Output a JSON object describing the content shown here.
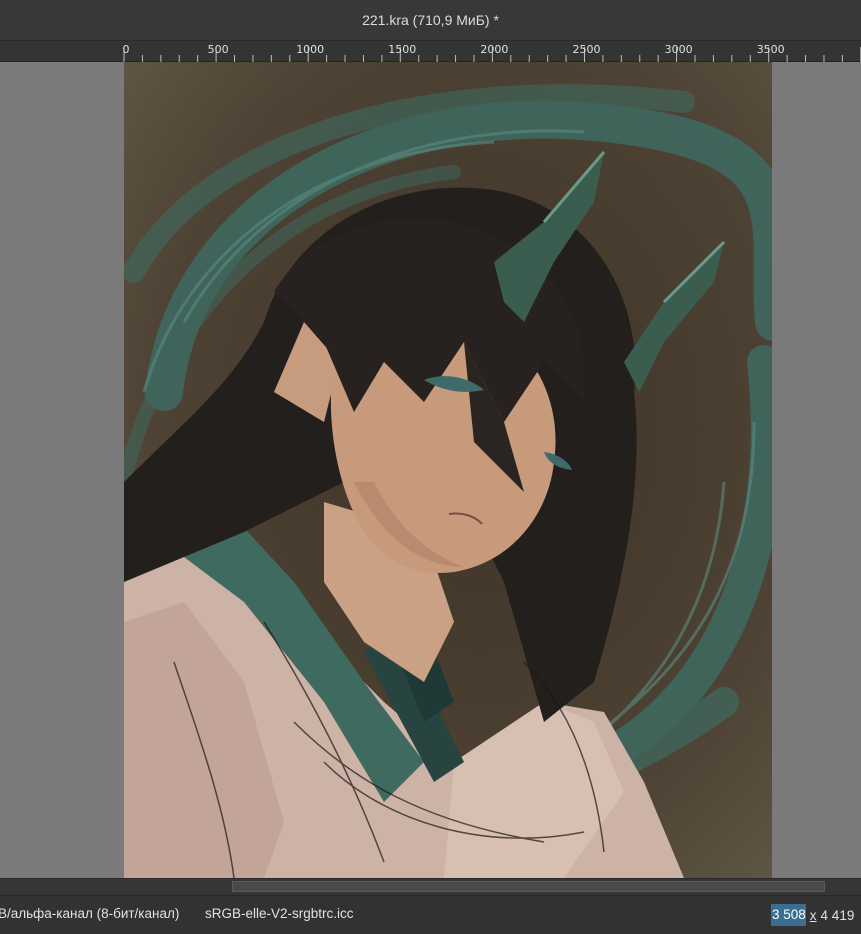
{
  "window": {
    "title": "221.kra (710,9 МиБ) *"
  },
  "ruler": {
    "labels": [
      "0",
      "500",
      "1000",
      "1500",
      "2000",
      "2500",
      "3000",
      "3500"
    ]
  },
  "canvas": {
    "artwork": "digital painting: dark-haired figure with green dragon horns and pointed ear, teal brush swirls on brown background"
  },
  "statusbar": {
    "color_space": "В/альфа-канал (8-бит/канал)",
    "profile": "sRGB-elle-V2-srgbtrc.icc",
    "width": "3 508",
    "height": "4 419",
    "separator": "x"
  },
  "colors": {
    "accent": "#3a6e93",
    "background": "#7a7a7a",
    "toolbar": "#343434"
  }
}
